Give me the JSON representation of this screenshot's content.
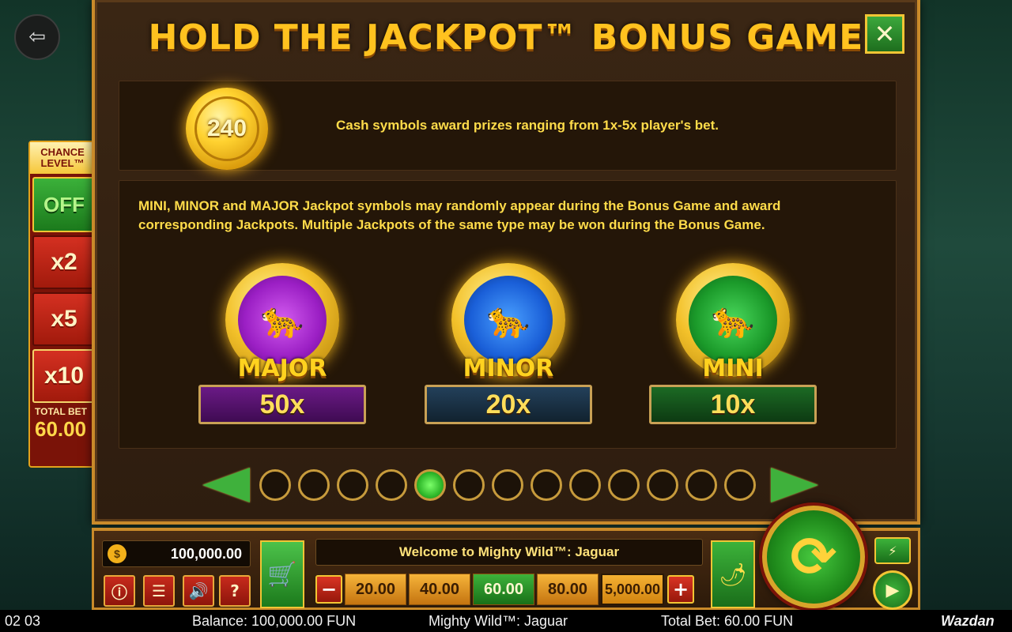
{
  "dialog": {
    "title": "HOLD THE JACKPOT™ BONUS GAME",
    "close_label": "✕",
    "coin_value": "240",
    "cash_text": "Cash symbols award prizes ranging from 1x-5x player's bet.",
    "jackpot_text": "MINI, MINOR and MAJOR Jackpot symbols may randomly appear during the Bonus Game and award corresponding Jackpots. Multiple Jackpots of the same type may be won during the Bonus Game.",
    "jackpots": [
      {
        "name": "MAJOR",
        "value": "50x",
        "color": "#9b1fc4"
      },
      {
        "name": "MINOR",
        "value": "20x",
        "color": "#1a5fd8"
      },
      {
        "name": "MINI",
        "value": "10x",
        "color": "#1b9a2a"
      }
    ],
    "pager": {
      "pages": 13,
      "active_index": 4
    }
  },
  "chance_level": {
    "title_line1": "CHANCE",
    "title_line2": "LEVEL™",
    "off_label": "OFF",
    "multipliers": [
      "x2",
      "x5",
      "x10"
    ],
    "total_bet_label": "TOTAL BET",
    "total_bet_value": "60.00"
  },
  "controls": {
    "balance": "100,000.00",
    "welcome": "Welcome to Mighty Wild™: Jaguar",
    "bet_options": [
      "20.00",
      "40.00",
      "60.00",
      "80.00",
      "5,000.00"
    ],
    "selected_bet": "60.00",
    "minus": "−",
    "plus": "+"
  },
  "status_bar": {
    "clock": "02 03",
    "balance": "Balance: 100,000.00 FUN",
    "game_name": "Mighty Wild™: Jaguar",
    "total_bet": "Total Bet: 60.00 FUN",
    "brand": "Wazdan"
  },
  "colors": {
    "accent_gold": "#ffc21f",
    "frame": "#c98a2a",
    "green_button": "#3cb23a",
    "red_button": "#c72a1c"
  }
}
